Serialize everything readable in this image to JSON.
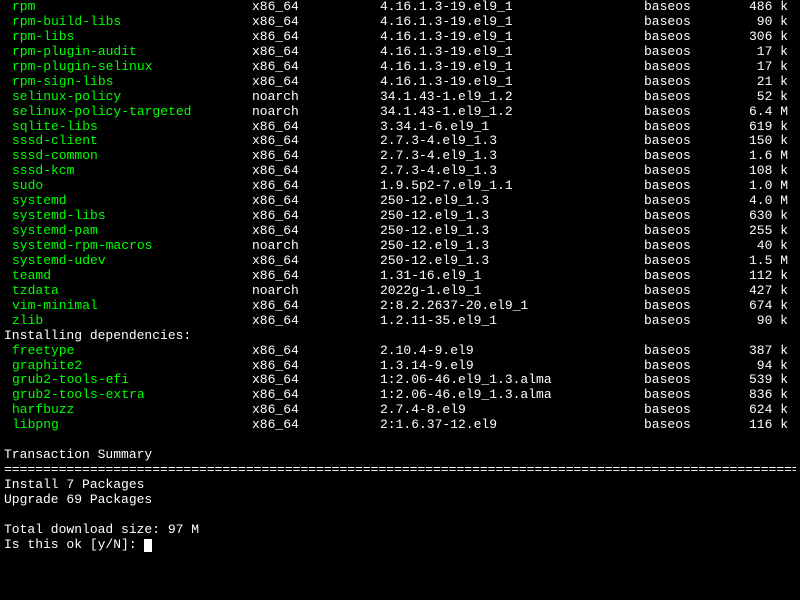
{
  "upgrades": [
    {
      "name": "rpm",
      "arch": "x86_64",
      "ver": "4.16.1.3-19.el9_1",
      "repo": "baseos",
      "size": "486 k"
    },
    {
      "name": "rpm-build-libs",
      "arch": "x86_64",
      "ver": "4.16.1.3-19.el9_1",
      "repo": "baseos",
      "size": "90 k"
    },
    {
      "name": "rpm-libs",
      "arch": "x86_64",
      "ver": "4.16.1.3-19.el9_1",
      "repo": "baseos",
      "size": "306 k"
    },
    {
      "name": "rpm-plugin-audit",
      "arch": "x86_64",
      "ver": "4.16.1.3-19.el9_1",
      "repo": "baseos",
      "size": "17 k"
    },
    {
      "name": "rpm-plugin-selinux",
      "arch": "x86_64",
      "ver": "4.16.1.3-19.el9_1",
      "repo": "baseos",
      "size": "17 k"
    },
    {
      "name": "rpm-sign-libs",
      "arch": "x86_64",
      "ver": "4.16.1.3-19.el9_1",
      "repo": "baseos",
      "size": "21 k"
    },
    {
      "name": "selinux-policy",
      "arch": "noarch",
      "ver": "34.1.43-1.el9_1.2",
      "repo": "baseos",
      "size": "52 k"
    },
    {
      "name": "selinux-policy-targeted",
      "arch": "noarch",
      "ver": "34.1.43-1.el9_1.2",
      "repo": "baseos",
      "size": "6.4 M"
    },
    {
      "name": "sqlite-libs",
      "arch": "x86_64",
      "ver": "3.34.1-6.el9_1",
      "repo": "baseos",
      "size": "619 k"
    },
    {
      "name": "sssd-client",
      "arch": "x86_64",
      "ver": "2.7.3-4.el9_1.3",
      "repo": "baseos",
      "size": "150 k"
    },
    {
      "name": "sssd-common",
      "arch": "x86_64",
      "ver": "2.7.3-4.el9_1.3",
      "repo": "baseos",
      "size": "1.6 M"
    },
    {
      "name": "sssd-kcm",
      "arch": "x86_64",
      "ver": "2.7.3-4.el9_1.3",
      "repo": "baseos",
      "size": "108 k"
    },
    {
      "name": "sudo",
      "arch": "x86_64",
      "ver": "1.9.5p2-7.el9_1.1",
      "repo": "baseos",
      "size": "1.0 M"
    },
    {
      "name": "systemd",
      "arch": "x86_64",
      "ver": "250-12.el9_1.3",
      "repo": "baseos",
      "size": "4.0 M"
    },
    {
      "name": "systemd-libs",
      "arch": "x86_64",
      "ver": "250-12.el9_1.3",
      "repo": "baseos",
      "size": "630 k"
    },
    {
      "name": "systemd-pam",
      "arch": "x86_64",
      "ver": "250-12.el9_1.3",
      "repo": "baseos",
      "size": "255 k"
    },
    {
      "name": "systemd-rpm-macros",
      "arch": "noarch",
      "ver": "250-12.el9_1.3",
      "repo": "baseos",
      "size": "40 k"
    },
    {
      "name": "systemd-udev",
      "arch": "x86_64",
      "ver": "250-12.el9_1.3",
      "repo": "baseos",
      "size": "1.5 M"
    },
    {
      "name": "teamd",
      "arch": "x86_64",
      "ver": "1.31-16.el9_1",
      "repo": "baseos",
      "size": "112 k"
    },
    {
      "name": "tzdata",
      "arch": "noarch",
      "ver": "2022g-1.el9_1",
      "repo": "baseos",
      "size": "427 k"
    },
    {
      "name": "vim-minimal",
      "arch": "x86_64",
      "ver": "2:8.2.2637-20.el9_1",
      "repo": "baseos",
      "size": "674 k"
    },
    {
      "name": "zlib",
      "arch": "x86_64",
      "ver": "1.2.11-35.el9_1",
      "repo": "baseos",
      "size": "90 k"
    }
  ],
  "deps_header": "Installing dependencies:",
  "deps": [
    {
      "name": "freetype",
      "arch": "x86_64",
      "ver": "2.10.4-9.el9",
      "repo": "baseos",
      "size": "387 k"
    },
    {
      "name": "graphite2",
      "arch": "x86_64",
      "ver": "1.3.14-9.el9",
      "repo": "baseos",
      "size": "94 k"
    },
    {
      "name": "grub2-tools-efi",
      "arch": "x86_64",
      "ver": "1:2.06-46.el9_1.3.alma",
      "repo": "baseos",
      "size": "539 k"
    },
    {
      "name": "grub2-tools-extra",
      "arch": "x86_64",
      "ver": "1:2.06-46.el9_1.3.alma",
      "repo": "baseos",
      "size": "836 k"
    },
    {
      "name": "harfbuzz",
      "arch": "x86_64",
      "ver": "2.7.4-8.el9",
      "repo": "baseos",
      "size": "624 k"
    },
    {
      "name": "libpng",
      "arch": "x86_64",
      "ver": "2:1.6.37-12.el9",
      "repo": "baseos",
      "size": "116 k"
    }
  ],
  "summary": {
    "title": "Transaction Summary",
    "divider": "================================================================================================================",
    "install_line": "Install   7 Packages",
    "upgrade_line": "Upgrade  69 Packages",
    "blank": "",
    "download_size": "Total download size: 97 M",
    "prompt": "Is this ok [y/N]: "
  }
}
